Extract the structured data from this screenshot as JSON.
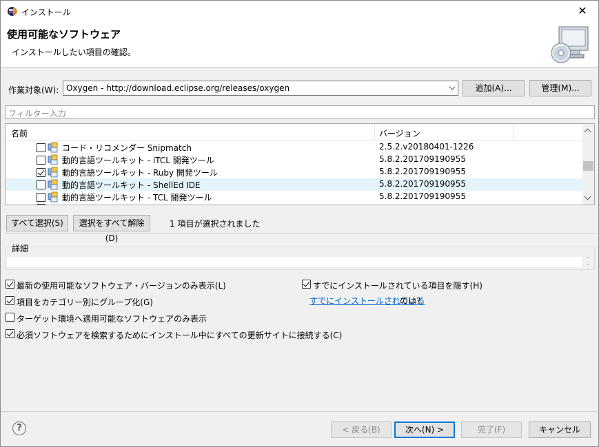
{
  "window": {
    "title": "インストール",
    "close": "✕"
  },
  "header": {
    "title": "使用可能なソフトウェア",
    "subtitle": "インストールしたい項目の確認。"
  },
  "work_with": {
    "label": "作業対象(W):",
    "value": "Oxygen - http://download.eclipse.org/releases/oxygen",
    "add_button": "追加(A)...",
    "manage_button": "管理(M)..."
  },
  "filter": {
    "placeholder": "フィルター入力"
  },
  "tree": {
    "columns": {
      "name": "名前",
      "version": "バージョン"
    },
    "rows": [
      {
        "name": "コード・リコメンダー Snipmatch",
        "version": "2.5.2.v20180401-1226",
        "checked": false,
        "hover": false
      },
      {
        "name": "動的言語ツールキット - iTCL 開発ツール",
        "version": "5.8.2.201709190955",
        "checked": false,
        "hover": false
      },
      {
        "name": "動的言語ツールキット - Ruby 開発ツール",
        "version": "5.8.2.201709190955",
        "checked": true,
        "hover": false
      },
      {
        "name": "動的言語ツールキット - ShellEd IDE",
        "version": "5.8.2.201709190955",
        "checked": false,
        "hover": true
      },
      {
        "name": "動的言語ツールキット - TCL 開発ツール",
        "version": "5.8.2.201709190955",
        "checked": false,
        "hover": false
      }
    ]
  },
  "selection": {
    "select_all": "すべて選択(S)",
    "deselect_all": "選択をすべて解除(D)",
    "status": "1 項目が選択されました"
  },
  "details": {
    "label": "詳細"
  },
  "options": {
    "latest_only": {
      "label": "最新の使用可能なソフトウェア・バージョンのみ表示(L)",
      "checked": true
    },
    "group_by_category": {
      "label": "項目をカテゴリー別にグループ化(G)",
      "checked": true
    },
    "target_env_only": {
      "label": "ターゲット環境へ適用可能なソフトウェアのみ表示",
      "checked": false
    },
    "contact_all_sites": {
      "label": "必須ソフトウェアを検索するためにインストール中にすべての更新サイトに接続する(C)",
      "checked": true
    },
    "hide_installed": {
      "label": "すでにインストールされている項目を隠す(H)",
      "checked": true
    }
  },
  "installed_link": {
    "text": "すでにインストールされている",
    "suffix": "のは?"
  },
  "footer": {
    "back": "< 戻る(B)",
    "next": "次へ(N) >",
    "finish": "完了(F)",
    "cancel": "キャンセル"
  },
  "colors": {
    "link": "#0066cc",
    "hover_row": "#e5f3fb",
    "default_button_border": "#0078d7"
  }
}
